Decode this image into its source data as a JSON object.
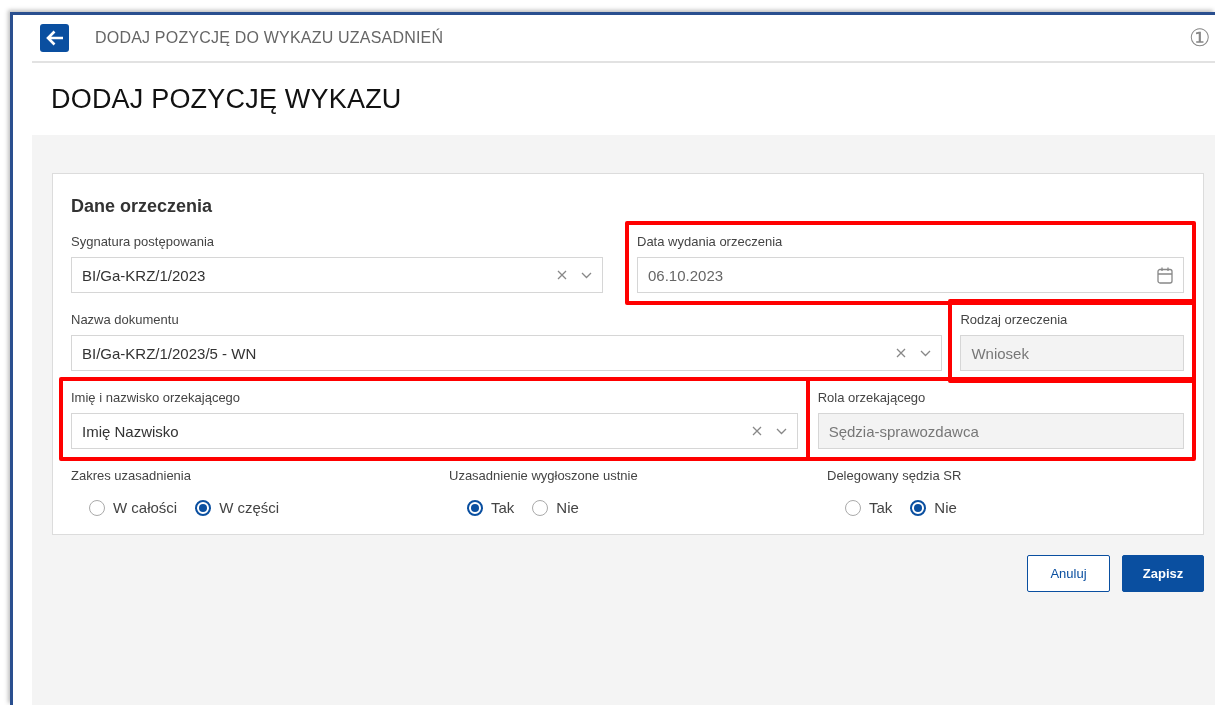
{
  "header": {
    "title": "DODAJ POZYCJĘ DO WYKAZU UZASADNIEŃ",
    "info_badge": "①"
  },
  "heading": "DODAJ POZYCJĘ WYKAZU",
  "section": {
    "title": "Dane orzeczenia",
    "rows": [
      [
        {
          "label": "Sygnatura postępowania",
          "value": "BI/Ga-KRZ/1/2023",
          "kind": "select",
          "highlighted": false
        },
        {
          "label": "Data wydania orzeczenia",
          "value": "06.10.2023",
          "kind": "date",
          "highlighted": true
        }
      ],
      [
        {
          "label": "Nazwa dokumentu",
          "value": "BI/Ga-KRZ/1/2023/5 - WN",
          "kind": "select",
          "highlighted": false
        },
        {
          "label": "Rodzaj orzeczenia",
          "value": "Wniosek",
          "kind": "readonly",
          "highlighted": true
        }
      ],
      [
        {
          "label": "Imię i nazwisko orzekającego",
          "value": "Imię Nazwisko",
          "kind": "select",
          "highlighted": true
        },
        {
          "label": "Rola orzekającego",
          "value": "Sędzia-sprawozdawca",
          "kind": "readonly",
          "highlighted": true
        }
      ]
    ],
    "radio_groups": [
      {
        "label": "Zakres uzasadnienia",
        "options": [
          {
            "label": "W całości",
            "selected": false
          },
          {
            "label": "W części",
            "selected": true
          }
        ]
      },
      {
        "label": "Uzasadnienie wygłoszone ustnie",
        "options": [
          {
            "label": "Tak",
            "selected": true
          },
          {
            "label": "Nie",
            "selected": false
          }
        ]
      },
      {
        "label": "Delegowany sędzia SR",
        "options": [
          {
            "label": "Tak",
            "selected": false
          },
          {
            "label": "Nie",
            "selected": true
          }
        ]
      }
    ]
  },
  "buttons": [
    {
      "label": "Anuluj",
      "kind": "secondary"
    },
    {
      "label": "Zapisz",
      "kind": "primary"
    }
  ]
}
